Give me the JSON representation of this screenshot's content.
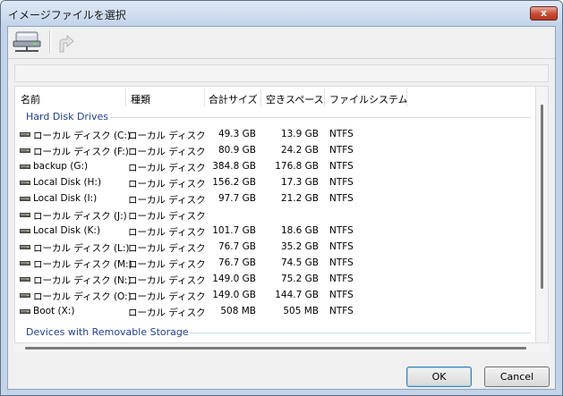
{
  "window": {
    "title": "イメージファイルを選択",
    "close_label": "x"
  },
  "toolbar": {
    "items": [
      {
        "icon": "network-drive-icon"
      },
      {
        "icon": "up-folder-icon"
      }
    ]
  },
  "columns": [
    "名前",
    "種類",
    "合計サイズ",
    "空きスペース",
    "ファイルシステム"
  ],
  "groups": [
    {
      "label": "Hard Disk Drives",
      "rows": [
        {
          "name": "ローカル ディスク (C:)",
          "type": "ローカル ディスク",
          "total": "49.3 GB",
          "free": "13.9 GB",
          "fs": "NTFS"
        },
        {
          "name": "ローカル ディスク (F:)",
          "type": "ローカル ディスク",
          "total": "80.9 GB",
          "free": "24.2 GB",
          "fs": "NTFS"
        },
        {
          "name": "backup (G:)",
          "type": "ローカル ディスク",
          "total": "384.8 GB",
          "free": "176.8 GB",
          "fs": "NTFS"
        },
        {
          "name": "Local Disk (H:)",
          "type": "ローカル ディスク",
          "total": "156.2 GB",
          "free": "17.3 GB",
          "fs": "NTFS"
        },
        {
          "name": "Local Disk (I:)",
          "type": "ローカル ディスク",
          "total": "97.7 GB",
          "free": "21.2 GB",
          "fs": "NTFS"
        },
        {
          "name": "ローカル ディスク (J:)",
          "type": "ローカル ディスク",
          "total": "",
          "free": "",
          "fs": ""
        },
        {
          "name": "Local Disk (K:)",
          "type": "ローカル ディスク",
          "total": "101.7 GB",
          "free": "18.6 GB",
          "fs": "NTFS"
        },
        {
          "name": "ローカル ディスク (L:)",
          "type": "ローカル ディスク",
          "total": "76.7 GB",
          "free": "35.2 GB",
          "fs": "NTFS"
        },
        {
          "name": "ローカル ディスク (M:)",
          "type": "ローカル ディスク",
          "total": "76.7 GB",
          "free": "74.5 GB",
          "fs": "NTFS"
        },
        {
          "name": "ローカル ディスク (N:)",
          "type": "ローカル ディスク",
          "total": "149.0 GB",
          "free": "75.2 GB",
          "fs": "NTFS"
        },
        {
          "name": "ローカル ディスク (O:)",
          "type": "ローカル ディスク",
          "total": "149.0 GB",
          "free": "144.7 GB",
          "fs": "NTFS"
        },
        {
          "name": "Boot (X:)",
          "type": "ローカル ディスク",
          "total": "508 MB",
          "free": "505 MB",
          "fs": "NTFS"
        }
      ]
    },
    {
      "label": "Devices with Removable Storage",
      "rows": []
    }
  ],
  "buttons": {
    "ok": "OK",
    "cancel": "Cancel"
  }
}
